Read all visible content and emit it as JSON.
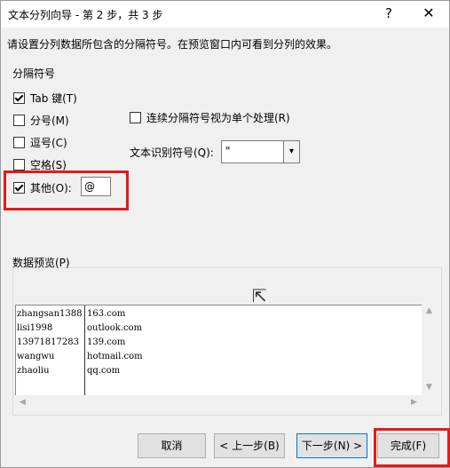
{
  "window": {
    "title": "文本分列向导 - 第 2 步，共 3 步",
    "help_glyph": "?",
    "close_glyph": "✕"
  },
  "instruction": "请设置分列数据所包含的分隔符号。在预览窗口内可看到分列的效果。",
  "delimiters": {
    "group_label": "分隔符号",
    "tab": {
      "label": "Tab 键(T)",
      "checked": true
    },
    "semicolon": {
      "label": "分号(M)",
      "checked": false
    },
    "comma": {
      "label": "逗号(C)",
      "checked": false
    },
    "space": {
      "label": "空格(S)",
      "checked": false
    },
    "other": {
      "label": "其他(O):",
      "checked": true,
      "value": "@"
    }
  },
  "options": {
    "consecutive_label": "连续分隔符号视为单个处理(R)",
    "qualifier_label": "文本识别符号(Q):",
    "qualifier_value": "\""
  },
  "preview": {
    "label": "数据预览(P)",
    "rows": [
      [
        "zhangsan1388",
        "163.com"
      ],
      [
        "lisi1998",
        "outlook.com"
      ],
      [
        "13971817283",
        "139.com"
      ],
      [
        "wangwu",
        "hotmail.com"
      ],
      [
        "zhaoliu",
        "qq.com"
      ]
    ]
  },
  "buttons": {
    "cancel": "取消",
    "back": "< 上一步(B)",
    "next": "下一步(N) >",
    "finish": "完成(F)"
  },
  "colors": {
    "highlight": "#e01b1b",
    "default_button_border": "#0078d7"
  }
}
